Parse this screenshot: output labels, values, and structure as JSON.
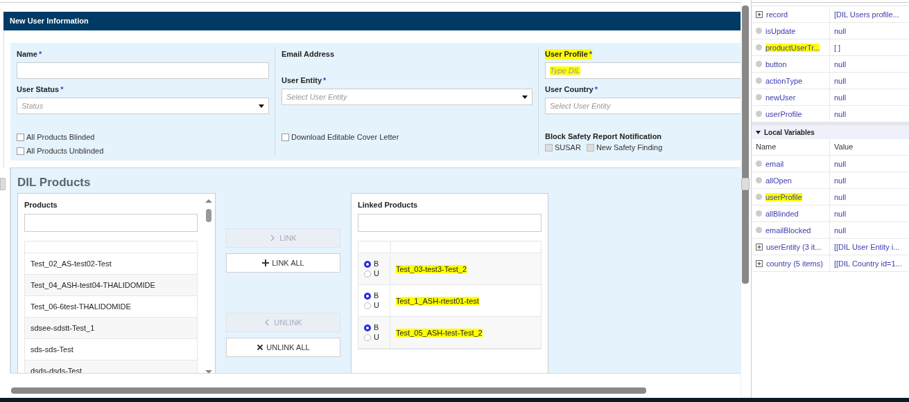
{
  "form": {
    "title": "New User Information",
    "columns": [
      {
        "fields": [
          {
            "label": "Name",
            "marker": "*",
            "kind": "text"
          },
          {
            "label": "User Status",
            "marker": "*",
            "kind": "select",
            "placeholder": "Status"
          }
        ],
        "checks": [
          {
            "label": "All Products Blinded",
            "checked": false,
            "disabled": false
          },
          {
            "label": "All Products Unblinded",
            "checked": false,
            "disabled": false
          }
        ]
      },
      {
        "fields": [
          {
            "label": "Email Address",
            "kind": "label"
          },
          {
            "label": "User Entity",
            "marker": "*",
            "kind": "select",
            "placeholder": "Select User Entity"
          }
        ],
        "checks": [
          {
            "label": "Download Editable Cover Letter",
            "checked": false,
            "disabled": false
          }
        ]
      },
      {
        "fields": [
          {
            "label": "User Profile",
            "marker": "*",
            "kind": "text",
            "placeholder": "Type DIL",
            "highlighted": true
          },
          {
            "label": "User Country",
            "marker": "*",
            "kind": "text",
            "placeholder": "Select User Entity"
          }
        ],
        "checks_title": "Block Safety Report Notification",
        "checks": [
          {
            "label": "SUSAR",
            "checked": false,
            "disabled": true
          },
          {
            "label": "New Safety Finding",
            "checked": false,
            "disabled": true
          }
        ]
      }
    ]
  },
  "products": {
    "title": "DIL Products",
    "available": {
      "title": "Products",
      "items": [
        "Test_02_AS-test02-Test",
        "Test_04_ASH-test04-THALIDOMIDE",
        "Test_06-6test-THALIDOMIDE",
        "sdsee-sdstt-Test_1",
        "sds-sds-Test",
        "dsds-dsds-Test"
      ]
    },
    "buttons": [
      {
        "label": "LINK",
        "kind": "link",
        "disabled": true
      },
      {
        "label": "LINK ALL",
        "kind": "linkall",
        "disabled": false
      },
      {
        "label": "UNLINK",
        "kind": "unlink",
        "disabled": true
      },
      {
        "label": "UNLINK ALL",
        "kind": "unlinkall",
        "disabled": false
      }
    ],
    "linked": {
      "title": "Linked Products",
      "rows": [
        {
          "name": "Test_03-test3-Test_2",
          "highlighted": true,
          "options": [
            {
              "label": "B",
              "selected": true
            },
            {
              "label": "U",
              "selected": false
            }
          ]
        },
        {
          "name": "Test_1_ASH-rtest01-test",
          "highlighted": true,
          "options": [
            {
              "label": "B",
              "selected": true
            },
            {
              "label": "U",
              "selected": false
            }
          ]
        },
        {
          "name": "Test_05_ASH-test-Test_2",
          "highlighted": true,
          "options": [
            {
              "label": "B",
              "selected": true
            },
            {
              "label": "U",
              "selected": false
            }
          ]
        }
      ]
    }
  },
  "variables": {
    "rows": [
      {
        "kind": "expandable",
        "name": "record",
        "value": "[DIL Users profile..."
      },
      {
        "kind": "leaf",
        "name": "isUpdate",
        "value": "null"
      },
      {
        "kind": "leaf",
        "name": "productUserTr...",
        "value": "[ ]",
        "highlighted": true
      },
      {
        "kind": "leaf",
        "name": "button",
        "value": "null"
      },
      {
        "kind": "leaf",
        "name": "actionType",
        "value": "null"
      },
      {
        "kind": "leaf",
        "name": "newUser",
        "value": "null"
      },
      {
        "kind": "leaf",
        "name": "userProfile",
        "value": "null"
      }
    ]
  },
  "local_variables": {
    "title": "Local Variables",
    "expanded": true,
    "columns": [
      "Name",
      "Value"
    ],
    "rows": [
      {
        "kind": "leaf",
        "name": "email",
        "value": "null"
      },
      {
        "kind": "leaf",
        "name": "allOpen",
        "value": "null"
      },
      {
        "kind": "leaf",
        "name": "userProfile",
        "value": "null",
        "highlighted": true
      },
      {
        "kind": "leaf",
        "name": "allBlinded",
        "value": "null"
      },
      {
        "kind": "leaf",
        "name": "emailBlocked",
        "value": "null"
      },
      {
        "kind": "expandable",
        "name": "userEntity (3 it...",
        "value": "[[DIL User Entity i..."
      },
      {
        "kind": "expandable",
        "name": "country (5 items)",
        "value": "[[DIL Country id=1..."
      }
    ]
  }
}
